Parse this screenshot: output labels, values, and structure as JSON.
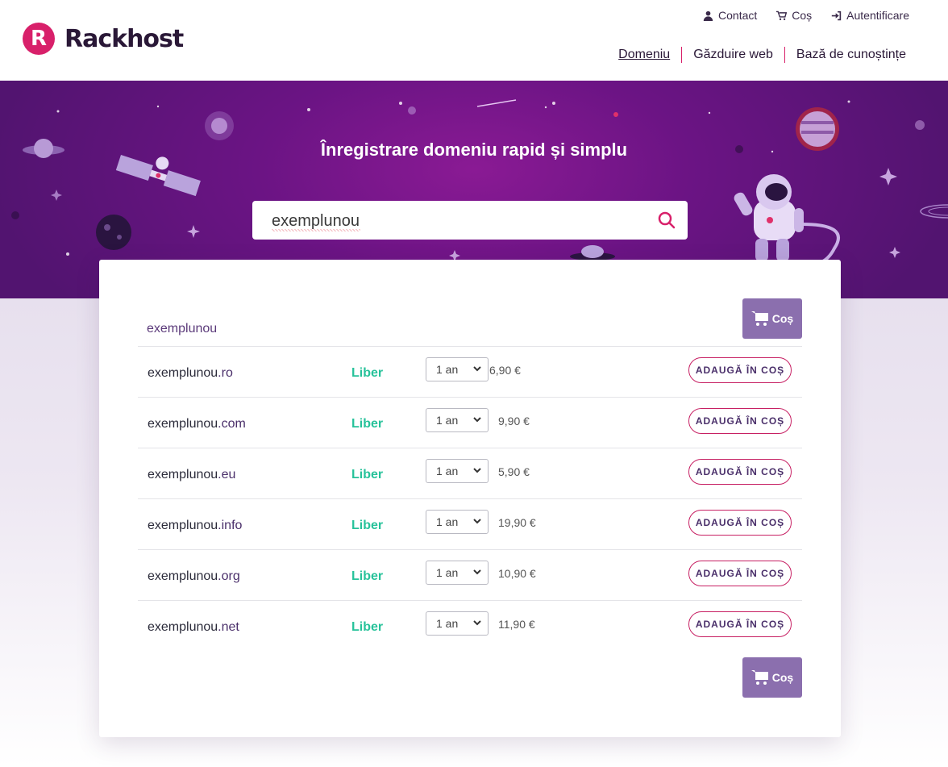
{
  "brand": {
    "name": "Rackhost",
    "mark": "R"
  },
  "top_links": {
    "contact": "Contact",
    "cart": "Coș",
    "login": "Autentificare"
  },
  "nav": {
    "domain": "Domeniu",
    "hosting": "Găzduire web",
    "knowledge": "Bază de cunoștințe"
  },
  "hero": {
    "title": "Înregistrare domeniu rapid și simplu"
  },
  "search": {
    "value": "exemplunou"
  },
  "results": {
    "query": "exemplunou",
    "cart_label": "Coș",
    "rows": [
      {
        "name": "exemplunou",
        "tld": ".ro",
        "status": "Liber",
        "period": "1 an",
        "price": "6,90 €",
        "action": "ADAUGĂ ÎN COȘ"
      },
      {
        "name": "exemplunou",
        "tld": ".com",
        "status": "Liber",
        "period": "1 an",
        "price": "9,90 €",
        "action": "ADAUGĂ ÎN COȘ"
      },
      {
        "name": "exemplunou",
        "tld": ".eu",
        "status": "Liber",
        "period": "1 an",
        "price": "5,90 €",
        "action": "ADAUGĂ ÎN COȘ"
      },
      {
        "name": "exemplunou",
        "tld": ".info",
        "status": "Liber",
        "period": "1 an",
        "price": "19,90 €",
        "action": "ADAUGĂ ÎN COȘ"
      },
      {
        "name": "exemplunou",
        "tld": ".org",
        "status": "Liber",
        "period": "1 an",
        "price": "10,90 €",
        "action": "ADAUGĂ ÎN COȘ"
      },
      {
        "name": "exemplunou",
        "tld": ".net",
        "status": "Liber",
        "period": "1 an",
        "price": "11,90 €",
        "action": "ADAUGĂ ÎN COȘ"
      }
    ]
  },
  "colors": {
    "brand": "#d8206a",
    "hero": "#6b1484",
    "free": "#27c29a",
    "cart_button": "#8b6fae"
  },
  "icons": {
    "contact": "user-icon",
    "cart": "cart-icon",
    "login": "sign-in-icon",
    "search": "search-icon"
  }
}
